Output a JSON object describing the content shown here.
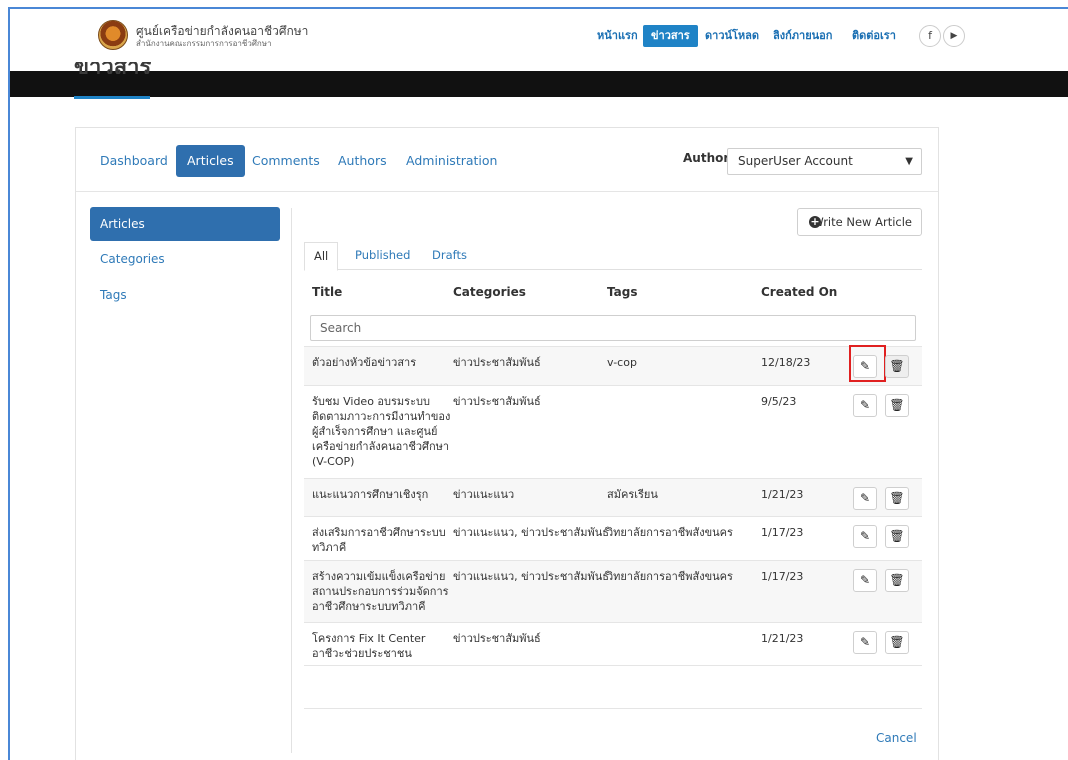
{
  "header": {
    "site_title": "ศูนย์เครือข่ายกำลังคนอาชีวศึกษา",
    "site_subtitle": "สำนักงานคณะกรรมการการอาชีวศึกษา",
    "nav": [
      {
        "label": "หน้าแรก",
        "active": false
      },
      {
        "label": "ข่าวสาร",
        "active": true
      },
      {
        "label": "ดาวน์โหลด",
        "active": false
      },
      {
        "label": "ลิงก์ภายนอก",
        "active": false
      },
      {
        "label": "ติดต่อเรา",
        "active": false
      }
    ],
    "social": [
      {
        "label": "f",
        "icon": "facebook-icon"
      },
      {
        "label": "▶",
        "icon": "youtube-icon"
      }
    ],
    "band_title": "ข่าวสาร"
  },
  "admin": {
    "top_tabs": [
      {
        "label": "Dashboard",
        "active": false
      },
      {
        "label": "Articles",
        "active": true
      },
      {
        "label": "Comments",
        "active": false
      },
      {
        "label": "Authors",
        "active": false
      },
      {
        "label": "Administration",
        "active": false
      }
    ],
    "author_label": "Author:",
    "author_value": "SuperUser Account",
    "sidebar": [
      {
        "label": "Articles",
        "active": true
      },
      {
        "label": "Categories",
        "active": false
      },
      {
        "label": "Tags",
        "active": false
      }
    ],
    "write_button": "Write New Article",
    "sub_tabs": [
      {
        "label": "All",
        "active": true
      },
      {
        "label": "Published",
        "active": false
      },
      {
        "label": "Drafts",
        "active": false
      }
    ],
    "columns": [
      "Title",
      "Categories",
      "Tags",
      "Created On"
    ],
    "search_placeholder": "Search",
    "rows": [
      {
        "title": "ตัวอย่างหัวข้อข่าวสาร",
        "categories": "ข่าวประชาสัมพันธ์",
        "tags": "v-cop",
        "created": "12/18/23",
        "highlighted": true
      },
      {
        "title": "รับชม Video อบรมระบบติดตามภาวะการมีงานทำของผู้สำเร็จการศึกษา และศูนย์เครือข่ายกำลังคนอาชีวศึกษา (V-COP)",
        "categories": "ข่าวประชาสัมพันธ์",
        "tags": "",
        "created": "9/5/23",
        "highlighted": false
      },
      {
        "title": "แนะแนวการศึกษาเชิงรุก",
        "categories": "ข่าวแนะแนว",
        "tags": "สมัครเรียน",
        "created": "1/21/23",
        "highlighted": false
      },
      {
        "title": "ส่งเสริมการอาชีวศึกษาระบบทวิภาคี",
        "categories": "ข่าวแนะแนว, ข่าวประชาสัมพันธ์",
        "tags": "วิทยาลัยการอาชีพสังขนคร",
        "created": "1/17/23",
        "highlighted": false
      },
      {
        "title": "สร้างความเข้มแข็งเครือข่ายสถานประกอบการร่วมจัดการอาชีวศึกษาระบบทวิภาคี",
        "categories": "ข่าวแนะแนว, ข่าวประชาสัมพันธ์",
        "tags": "วิทยาลัยการอาชีพสังขนคร",
        "created": "1/17/23",
        "highlighted": false
      },
      {
        "title": "โครงการ Fix It Center อาชีวะช่วยประชาชน",
        "categories": "ข่าวประชาสัมพันธ์",
        "tags": "",
        "created": "1/21/23",
        "highlighted": false
      }
    ],
    "cancel_label": "Cancel"
  },
  "colors": {
    "accent": "#2f6fae",
    "link": "#2f7ab8",
    "nav_active": "#1f83c6",
    "highlight_box": "#e02020"
  }
}
